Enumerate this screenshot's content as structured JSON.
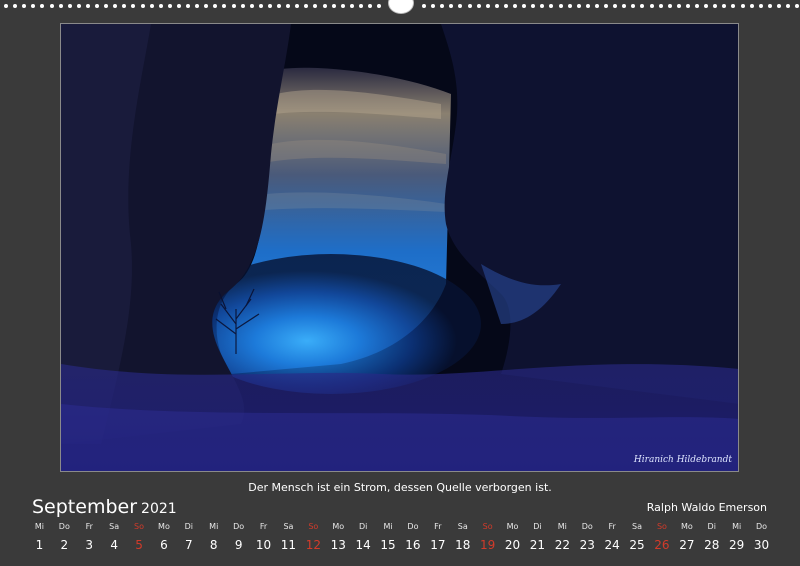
{
  "calendar": {
    "month": "September",
    "year": "2021",
    "quote": "Der Mensch ist ein Strom, dessen Quelle verborgen ist.",
    "author": "Ralph Waldo Emerson",
    "days": [
      {
        "dn": "Mi",
        "num": "1"
      },
      {
        "dn": "Do",
        "num": "2"
      },
      {
        "dn": "Fr",
        "num": "3"
      },
      {
        "dn": "Sa",
        "num": "4"
      },
      {
        "dn": "So",
        "num": "5",
        "sunday": true
      },
      {
        "dn": "Mo",
        "num": "6"
      },
      {
        "dn": "Di",
        "num": "7"
      },
      {
        "dn": "Mi",
        "num": "8"
      },
      {
        "dn": "Do",
        "num": "9"
      },
      {
        "dn": "Fr",
        "num": "10"
      },
      {
        "dn": "Sa",
        "num": "11"
      },
      {
        "dn": "So",
        "num": "12",
        "sunday": true
      },
      {
        "dn": "Mo",
        "num": "13"
      },
      {
        "dn": "Di",
        "num": "14"
      },
      {
        "dn": "Mi",
        "num": "15"
      },
      {
        "dn": "Do",
        "num": "16"
      },
      {
        "dn": "Fr",
        "num": "17"
      },
      {
        "dn": "Sa",
        "num": "18"
      },
      {
        "dn": "So",
        "num": "19",
        "sunday": true
      },
      {
        "dn": "Mo",
        "num": "20"
      },
      {
        "dn": "Di",
        "num": "21"
      },
      {
        "dn": "Mi",
        "num": "22"
      },
      {
        "dn": "Do",
        "num": "23"
      },
      {
        "dn": "Fr",
        "num": "24"
      },
      {
        "dn": "Sa",
        "num": "25"
      },
      {
        "dn": "So",
        "num": "26",
        "sunday": true
      },
      {
        "dn": "Mo",
        "num": "27"
      },
      {
        "dn": "Di",
        "num": "28"
      },
      {
        "dn": "Mi",
        "num": "29"
      },
      {
        "dn": "Do",
        "num": "30"
      }
    ],
    "colors": {
      "background": "#3a3a3a",
      "sunday": "#d23a2a",
      "text": "#ffffff"
    }
  },
  "photo": {
    "signature": "Hiranich Hildebrandt"
  }
}
